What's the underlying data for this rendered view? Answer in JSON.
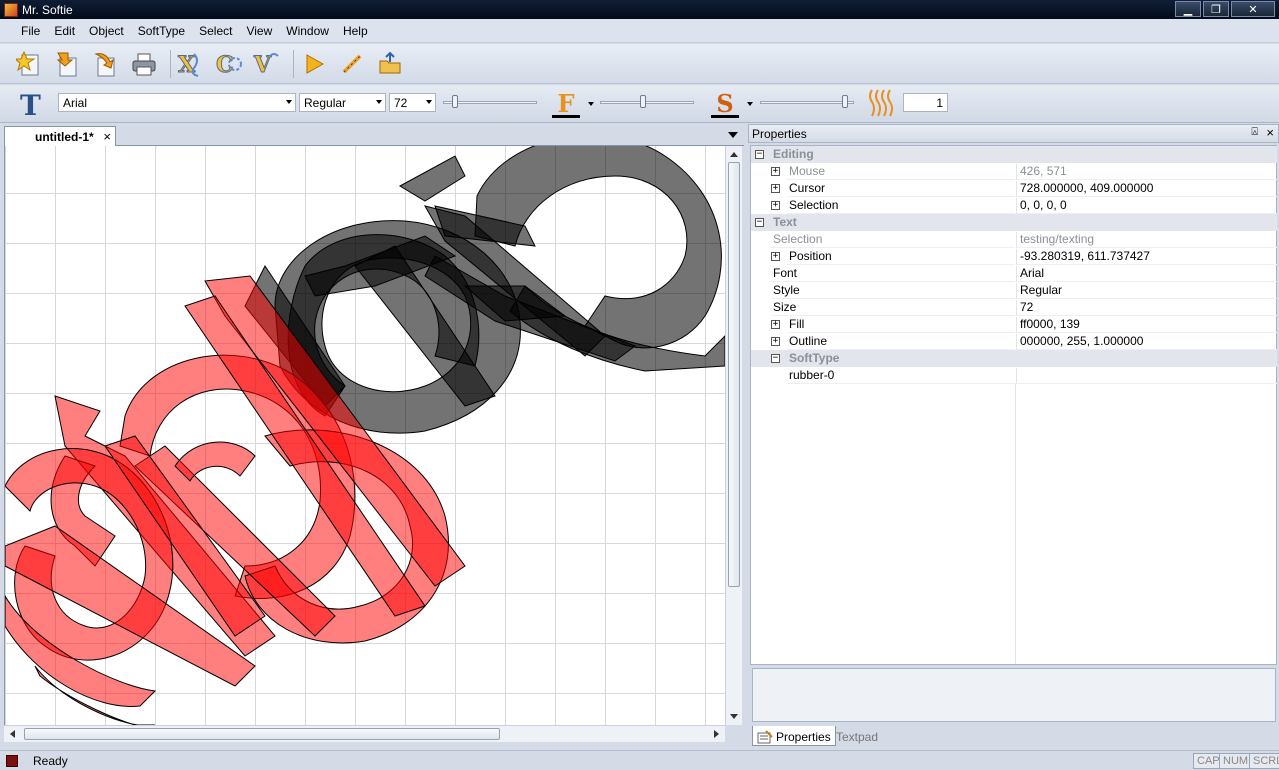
{
  "window": {
    "title": "Mr. Softie"
  },
  "menu": [
    "File",
    "Edit",
    "Object",
    "SoftType",
    "Select",
    "View",
    "Window",
    "Help"
  ],
  "format_bar": {
    "font": "Arial",
    "style": "Regular",
    "size": "72",
    "fill_glyph": "F",
    "outline_glyph": "S",
    "count": "1",
    "fill_slider": 0.47,
    "outline_slider": 0.95,
    "size_slider": 0.1
  },
  "document": {
    "tab_label": "untitled-1*",
    "close": "×"
  },
  "properties": {
    "title": "Properties",
    "pin": "⍓",
    "close": "×",
    "rows": [
      {
        "kind": "cat",
        "name": "Editing",
        "exp": "−"
      },
      {
        "kind": "prop",
        "name": "Mouse",
        "value": "426, 571",
        "exp": "+",
        "disabled": true
      },
      {
        "kind": "prop",
        "name": "Cursor",
        "value": "728.000000, 409.000000",
        "exp": "+"
      },
      {
        "kind": "prop",
        "name": "Selection",
        "value": "0, 0, 0, 0",
        "exp": "+"
      },
      {
        "kind": "cat",
        "name": "Text",
        "exp": "−"
      },
      {
        "kind": "prop",
        "name": "Selection",
        "value": "testing/texting",
        "disabled": true
      },
      {
        "kind": "prop",
        "name": "Position",
        "value": "-93.280319, 611.737427",
        "exp": "+"
      },
      {
        "kind": "prop",
        "name": "Font",
        "value": "Arial"
      },
      {
        "kind": "prop",
        "name": "Style",
        "value": "Regular"
      },
      {
        "kind": "prop",
        "name": "Size",
        "value": "72"
      },
      {
        "kind": "prop",
        "name": "Fill",
        "value": "ff0000, 139",
        "exp": "+"
      },
      {
        "kind": "prop",
        "name": "Outline",
        "value": "000000, 255, 1.000000",
        "exp": "+"
      },
      {
        "kind": "subcat",
        "name": "SoftType",
        "exp": "−"
      },
      {
        "kind": "prop",
        "name": "rubber-0",
        "value": "",
        "indent": true
      }
    ]
  },
  "panel_tabs": {
    "properties": "Properties",
    "textpad": "Textpad"
  },
  "status": {
    "text": "Ready",
    "cap": "CAP",
    "num": "NUM",
    "scrl": "SCRL"
  },
  "colors": {
    "fill_red": "#ff0000",
    "outline_black": "#000000",
    "glyph_orange": "#e89020"
  }
}
